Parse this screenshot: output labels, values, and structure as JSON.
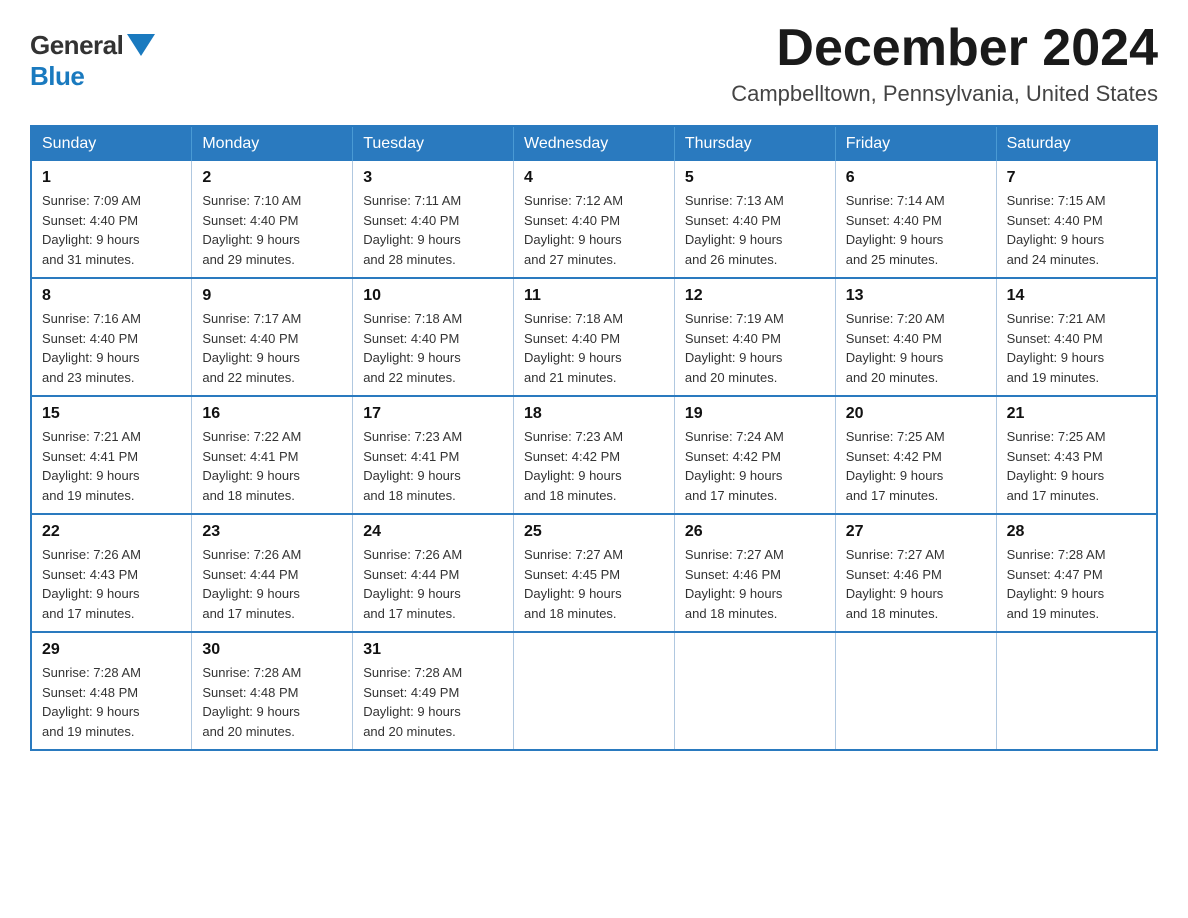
{
  "logo": {
    "general": "General",
    "blue": "Blue"
  },
  "header": {
    "month": "December 2024",
    "location": "Campbelltown, Pennsylvania, United States"
  },
  "weekdays": [
    "Sunday",
    "Monday",
    "Tuesday",
    "Wednesday",
    "Thursday",
    "Friday",
    "Saturday"
  ],
  "weeks": [
    [
      {
        "day": "1",
        "sunrise": "7:09 AM",
        "sunset": "4:40 PM",
        "daylight": "9 hours and 31 minutes."
      },
      {
        "day": "2",
        "sunrise": "7:10 AM",
        "sunset": "4:40 PM",
        "daylight": "9 hours and 29 minutes."
      },
      {
        "day": "3",
        "sunrise": "7:11 AM",
        "sunset": "4:40 PM",
        "daylight": "9 hours and 28 minutes."
      },
      {
        "day": "4",
        "sunrise": "7:12 AM",
        "sunset": "4:40 PM",
        "daylight": "9 hours and 27 minutes."
      },
      {
        "day": "5",
        "sunrise": "7:13 AM",
        "sunset": "4:40 PM",
        "daylight": "9 hours and 26 minutes."
      },
      {
        "day": "6",
        "sunrise": "7:14 AM",
        "sunset": "4:40 PM",
        "daylight": "9 hours and 25 minutes."
      },
      {
        "day": "7",
        "sunrise": "7:15 AM",
        "sunset": "4:40 PM",
        "daylight": "9 hours and 24 minutes."
      }
    ],
    [
      {
        "day": "8",
        "sunrise": "7:16 AM",
        "sunset": "4:40 PM",
        "daylight": "9 hours and 23 minutes."
      },
      {
        "day": "9",
        "sunrise": "7:17 AM",
        "sunset": "4:40 PM",
        "daylight": "9 hours and 22 minutes."
      },
      {
        "day": "10",
        "sunrise": "7:18 AM",
        "sunset": "4:40 PM",
        "daylight": "9 hours and 22 minutes."
      },
      {
        "day": "11",
        "sunrise": "7:18 AM",
        "sunset": "4:40 PM",
        "daylight": "9 hours and 21 minutes."
      },
      {
        "day": "12",
        "sunrise": "7:19 AM",
        "sunset": "4:40 PM",
        "daylight": "9 hours and 20 minutes."
      },
      {
        "day": "13",
        "sunrise": "7:20 AM",
        "sunset": "4:40 PM",
        "daylight": "9 hours and 20 minutes."
      },
      {
        "day": "14",
        "sunrise": "7:21 AM",
        "sunset": "4:40 PM",
        "daylight": "9 hours and 19 minutes."
      }
    ],
    [
      {
        "day": "15",
        "sunrise": "7:21 AM",
        "sunset": "4:41 PM",
        "daylight": "9 hours and 19 minutes."
      },
      {
        "day": "16",
        "sunrise": "7:22 AM",
        "sunset": "4:41 PM",
        "daylight": "9 hours and 18 minutes."
      },
      {
        "day": "17",
        "sunrise": "7:23 AM",
        "sunset": "4:41 PM",
        "daylight": "9 hours and 18 minutes."
      },
      {
        "day": "18",
        "sunrise": "7:23 AM",
        "sunset": "4:42 PM",
        "daylight": "9 hours and 18 minutes."
      },
      {
        "day": "19",
        "sunrise": "7:24 AM",
        "sunset": "4:42 PM",
        "daylight": "9 hours and 17 minutes."
      },
      {
        "day": "20",
        "sunrise": "7:25 AM",
        "sunset": "4:42 PM",
        "daylight": "9 hours and 17 minutes."
      },
      {
        "day": "21",
        "sunrise": "7:25 AM",
        "sunset": "4:43 PM",
        "daylight": "9 hours and 17 minutes."
      }
    ],
    [
      {
        "day": "22",
        "sunrise": "7:26 AM",
        "sunset": "4:43 PM",
        "daylight": "9 hours and 17 minutes."
      },
      {
        "day": "23",
        "sunrise": "7:26 AM",
        "sunset": "4:44 PM",
        "daylight": "9 hours and 17 minutes."
      },
      {
        "day": "24",
        "sunrise": "7:26 AM",
        "sunset": "4:44 PM",
        "daylight": "9 hours and 17 minutes."
      },
      {
        "day": "25",
        "sunrise": "7:27 AM",
        "sunset": "4:45 PM",
        "daylight": "9 hours and 18 minutes."
      },
      {
        "day": "26",
        "sunrise": "7:27 AM",
        "sunset": "4:46 PM",
        "daylight": "9 hours and 18 minutes."
      },
      {
        "day": "27",
        "sunrise": "7:27 AM",
        "sunset": "4:46 PM",
        "daylight": "9 hours and 18 minutes."
      },
      {
        "day": "28",
        "sunrise": "7:28 AM",
        "sunset": "4:47 PM",
        "daylight": "9 hours and 19 minutes."
      }
    ],
    [
      {
        "day": "29",
        "sunrise": "7:28 AM",
        "sunset": "4:48 PM",
        "daylight": "9 hours and 19 minutes."
      },
      {
        "day": "30",
        "sunrise": "7:28 AM",
        "sunset": "4:48 PM",
        "daylight": "9 hours and 20 minutes."
      },
      {
        "day": "31",
        "sunrise": "7:28 AM",
        "sunset": "4:49 PM",
        "daylight": "9 hours and 20 minutes."
      },
      null,
      null,
      null,
      null
    ]
  ],
  "labels": {
    "sunrise": "Sunrise: ",
    "sunset": "Sunset: ",
    "daylight": "Daylight: "
  }
}
